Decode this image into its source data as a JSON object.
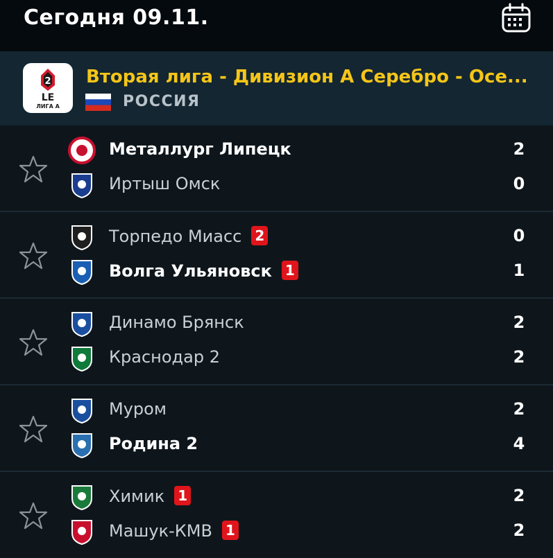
{
  "header": {
    "date_title": "Сегодня 09.11."
  },
  "league": {
    "name": "Вторая лига - Дивизион А Серебро - Осе...",
    "country": "РОССИЯ",
    "logo_text_top": "LE",
    "logo_text_bottom": "ЛИГА А"
  },
  "colors": {
    "accent": "#f5c518",
    "card": "#e0151b",
    "header_bg": "#132631",
    "bg": "#0e161c"
  },
  "matches": [
    {
      "home": {
        "name": "Металлург Липецк",
        "score": "2",
        "winner": true,
        "card": ""
      },
      "away": {
        "name": "Иртыш Омск",
        "score": "0",
        "winner": false,
        "card": ""
      }
    },
    {
      "home": {
        "name": "Торпедо Миасс",
        "score": "0",
        "winner": false,
        "card": "2"
      },
      "away": {
        "name": "Волга Ульяновск",
        "score": "1",
        "winner": true,
        "card": "1"
      }
    },
    {
      "home": {
        "name": "Динамо Брянск",
        "score": "2",
        "winner": false,
        "card": ""
      },
      "away": {
        "name": "Краснодар 2",
        "score": "2",
        "winner": false,
        "card": ""
      }
    },
    {
      "home": {
        "name": "Муром",
        "score": "2",
        "winner": false,
        "card": ""
      },
      "away": {
        "name": "Родина 2",
        "score": "4",
        "winner": true,
        "card": ""
      }
    },
    {
      "home": {
        "name": "Химик",
        "score": "2",
        "winner": false,
        "card": "1"
      },
      "away": {
        "name": "Машук-КМВ",
        "score": "2",
        "winner": false,
        "card": "1"
      }
    }
  ]
}
